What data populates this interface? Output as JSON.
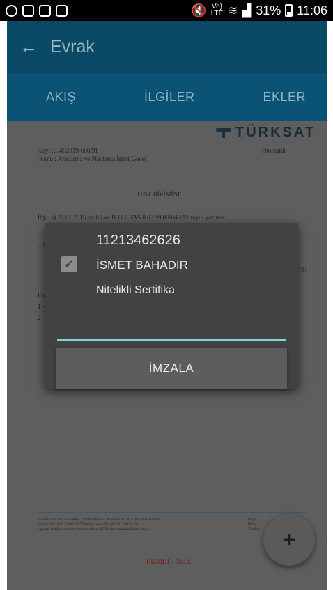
{
  "status_bar": {
    "lte_top": "Vo)",
    "lte_bottom": "LTE",
    "battery": "31%",
    "time": "11:06"
  },
  "app_bar": {
    "back_glyph": "←",
    "title": "Evrak"
  },
  "tabs": [
    {
      "label": "AKIŞ"
    },
    {
      "label": "İLGİLER"
    },
    {
      "label": "EKLER"
    }
  ],
  "document": {
    "logo_text": "TÜRKSAT",
    "sayi": "Sayı    :63452019-600/91",
    "konu": "Konu    : Araştırma ve Planlama İşleri(Genel)",
    "otomatik": "Otomatik",
    "recipient": "TEST BİRİMİNE",
    "ilgi": "İlgi     : a) 27.01.2015 tarihli ve B.11.6.TAS.0.07.99.00-042/12 sayılı yazımız.",
    "frag_trd": "trd",
    "frag_tu": "TU",
    "frag_ek": "Ek",
    "frag_1": "1 -",
    "frag_2": "2 -",
    "footer_line1": "Ticaret Sicil No: ANKARA 192881 Merkez: Konya Yolu 40.Km Gölbaşı 06839 /",
    "footer_line2": "Telefon No: (0312) 249 74 70 Belge Geçer No: (0312) 249 74 79",
    "footer_line3": "e-posta: test@test.com.tr internet adresi: KEP adresi:turksat@hs01.kep.tr",
    "footer_right1": "Bilgi",
    "footer_right2": "BT V",
    "footer_right3": "Telefon",
    "classification": "HİZMETE ÖZEL"
  },
  "dialog": {
    "certificate_id": "11213462626",
    "certificate_name": "İSMET BAHADIR",
    "certificate_type": "Nitelikli Sertifika",
    "checkbox_checked": true,
    "pin_value": "",
    "sign_button": "İMZALA"
  },
  "fab": {
    "glyph": "+"
  },
  "colors": {
    "app_bar": "#0a4a66",
    "tab_bar": "#0a5375",
    "dialog_bg": "#424242",
    "input_accent": "#7fd6cf"
  }
}
